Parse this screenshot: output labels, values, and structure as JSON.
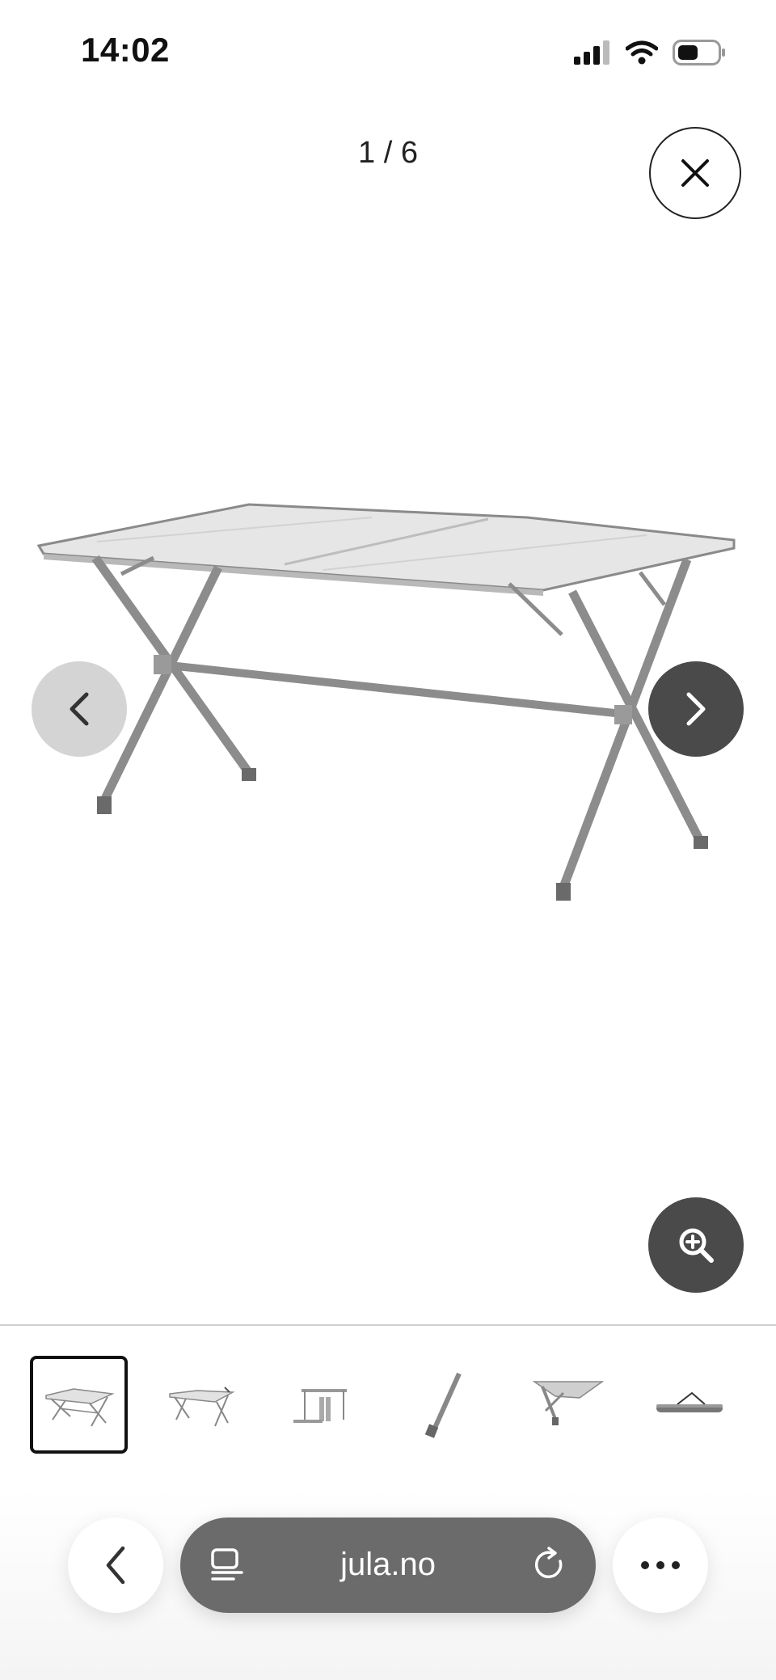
{
  "status_bar": {
    "time": "14:02"
  },
  "gallery": {
    "counter": "1 / 6",
    "image_alt": "Folding aluminium camping table"
  },
  "thumbnails": [
    {
      "name": "table-front",
      "active": true
    },
    {
      "name": "table-angle",
      "active": false
    },
    {
      "name": "table-side",
      "active": false
    },
    {
      "name": "table-leg",
      "active": false
    },
    {
      "name": "table-detail",
      "active": false
    },
    {
      "name": "table-bag",
      "active": false
    }
  ],
  "browser": {
    "url": "jula.no"
  },
  "colors": {
    "dark_button": "#4a4a4a",
    "light_button": "#d4d4d4",
    "url_pill": "#6b6b6b"
  },
  "icons": [
    "close-icon",
    "chevron-left-icon",
    "chevron-right-icon",
    "zoom-in-icon",
    "back-icon",
    "tabs-icon",
    "reload-icon",
    "more-icon"
  ]
}
